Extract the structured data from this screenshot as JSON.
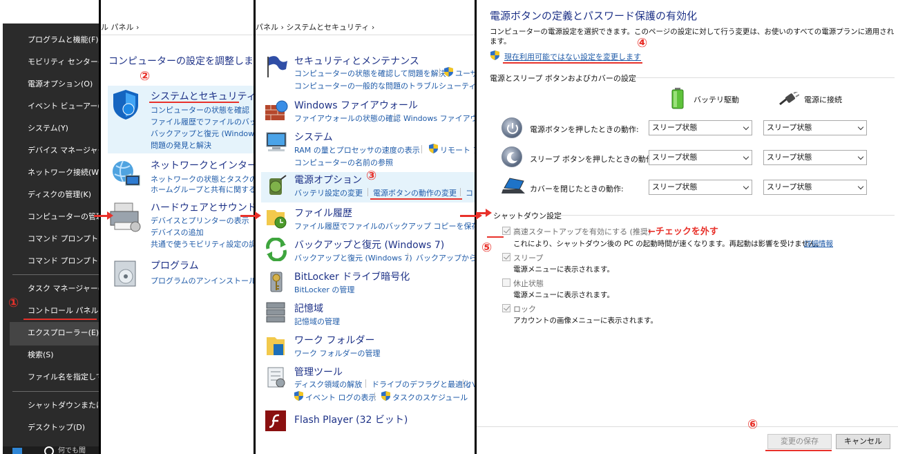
{
  "winx_menu": {
    "items": [
      "プログラムと機能(F)",
      "モビリティ センター(B)",
      "電源オプション(O)",
      "イベント ビューアー(V)",
      "システム(Y)",
      "デバイス マネージャー(M)",
      "ネットワーク接続(W)",
      "ディスクの管理(K)",
      "コンピューターの管理(G)",
      "コマンド プロンプト(C)",
      "コマンド プロンプト (管理者)(A)"
    ],
    "items2": [
      "タスク マネージャー(T)",
      "コントロール パネル(P)",
      "エクスプローラー(E)",
      "検索(S)",
      "ファイル名を指定して実行(R)"
    ],
    "items3": [
      "シャットダウンまたはサインアウト(U)",
      "デスクトップ(D)"
    ],
    "taskbar_text": "何でも聞"
  },
  "control_panel": {
    "breadcrumb": "ル パネル  ›",
    "title": "コンピューターの設定を調整します",
    "categories": [
      {
        "heading": "システムとセキュリティ",
        "links": [
          "コンピューターの状態を確認",
          "ファイル履歴でファイルのバックアップ",
          "バックアップと復元 (Windows 7)",
          "問題の発見と解決"
        ]
      },
      {
        "heading": "ネットワークとインターネット",
        "links": [
          "ネットワークの状態とタスクの表示",
          "ホームグループと共有に関するオプション"
        ]
      },
      {
        "heading": "ハードウェアとサウンド",
        "links": [
          "デバイスとプリンターの表示",
          "デバイスの追加",
          "共通で使うモビリティ設定の調整"
        ]
      },
      {
        "heading": "プログラム",
        "links": [
          "プログラムのアンインストール"
        ]
      }
    ]
  },
  "system_security": {
    "breadcrumb": "パネル  ›  システムとセキュリティ  ›",
    "sections": [
      {
        "heading": "セキュリティとメンテナンス",
        "line1": [
          "コンピューターの状態を確認して問題を解決",
          "ユーザー"
        ],
        "line2": [
          "コンピューターの一般的な問題のトラブルシューティング"
        ]
      },
      {
        "heading": "Windows ファイアウォール",
        "line1": [
          "ファイアウォールの状態の確認",
          "Windows ファイアウォール"
        ]
      },
      {
        "heading": "システム",
        "line1": [
          "RAM の量とプロセッサの速度の表示",
          "リモート アク"
        ],
        "line2": [
          "コンピューターの名前の参照"
        ]
      },
      {
        "heading": "電源オプション",
        "line1": [
          "バッテリ設定の変更",
          "電源ボタンの動作の変更",
          "コ"
        ]
      },
      {
        "heading": "ファイル履歴",
        "line1": [
          "ファイル履歴でファイルのバックアップ コピーを保存"
        ]
      },
      {
        "heading": "バックアップと復元 (Windows 7)",
        "line1": [
          "バックアップと復元 (Windows 7)",
          "バックアップからファ"
        ]
      },
      {
        "heading": "BitLocker ドライブ暗号化",
        "line1": [
          "BitLocker の管理"
        ]
      },
      {
        "heading": "記憶域",
        "line1": [
          "記憶域の管理"
        ]
      },
      {
        "heading": "ワーク フォルダー",
        "line1": [
          "ワーク フォルダーの管理"
        ]
      },
      {
        "heading": "管理ツール",
        "line1": [
          "ディスク領域の解放",
          "ドライブのデフラグと最適化",
          "ハ"
        ],
        "line2": [
          "イベント ログの表示",
          "タスクのスケジュール"
        ]
      },
      {
        "heading": "Flash Player (32 ビット)"
      }
    ]
  },
  "power_buttons": {
    "title": "電源ボタンの定義とパスワード保護の有効化",
    "description": "コンピューターの電源設定を選択できます。このページの設定に対して行う変更は、お使いのすべての電源プランに適用されます。",
    "change_link": "現在利用可能ではない設定を変更します",
    "group1": "電源とスリープ ボタンおよびカバーの設定",
    "col_battery": "バッテリ駆動",
    "col_plugged": "電源に接続",
    "rows": [
      {
        "label": "電源ボタンを押したときの動作:",
        "battery": "スリープ状態",
        "plugged": "スリープ状態"
      },
      {
        "label": "スリープ ボタンを押したときの動作:",
        "battery": "スリープ状態",
        "plugged": "スリープ状態"
      },
      {
        "label": "カバーを閉じたときの動作:",
        "battery": "スリープ状態",
        "plugged": "スリープ状態"
      }
    ],
    "group2": "シャットダウン設定",
    "fast_startup": {
      "label": "高速スタートアップを有効にする (推奨)",
      "desc": "これにより、シャットダウン後の PC の起動時間が速くなります。再起動は影響を受けません。",
      "more": "詳細情報"
    },
    "sleep": {
      "label": "スリープ",
      "desc": "電源メニューに表示されます。"
    },
    "hibernate": {
      "label": "休止状態",
      "desc": "電源メニューに表示されます。"
    },
    "lock": {
      "label": "ロック",
      "desc": "アカウントの画像メニューに表示されます。"
    },
    "save_label": "変更の保存",
    "cancel_label": "キャンセル"
  },
  "annotations": {
    "n1": "①",
    "n2": "②",
    "n3": "③",
    "n4": "④",
    "n5": "⑤",
    "n6": "⑥",
    "uncheck_note": "←チェックを外す"
  },
  "colors": {
    "accent_red": "#e8312a",
    "link_blue": "#1e5aa8",
    "heading_blue": "#1e3287"
  }
}
